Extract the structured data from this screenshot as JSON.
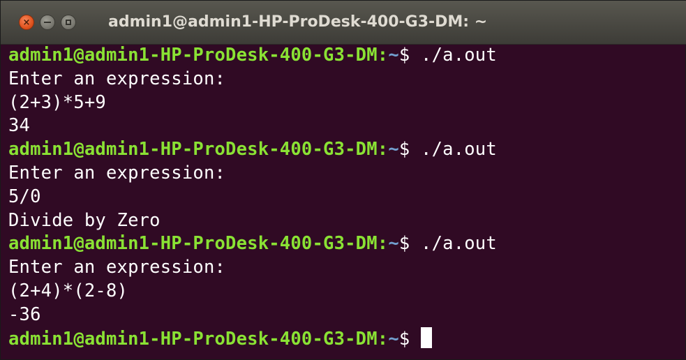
{
  "window": {
    "title": "admin1@admin1-HP-ProDesk-400-G3-DM: ~",
    "close_glyph": "×"
  },
  "terminal": {
    "prompt_user": "admin1@admin1-HP-ProDesk-400-G3-DM",
    "prompt_sep": ":",
    "prompt_path": "~",
    "prompt_symbol": "$",
    "lines": [
      {
        "type": "prompt",
        "command": "./a.out"
      },
      {
        "type": "output",
        "text": "Enter an expression:"
      },
      {
        "type": "output",
        "text": "(2+3)*5+9"
      },
      {
        "type": "output",
        "text": "34"
      },
      {
        "type": "prompt",
        "command": "./a.out"
      },
      {
        "type": "output",
        "text": "Enter an expression:"
      },
      {
        "type": "output",
        "text": "5/0"
      },
      {
        "type": "output",
        "text": "Divide by Zero"
      },
      {
        "type": "prompt",
        "command": "./a.out"
      },
      {
        "type": "output",
        "text": "Enter an expression:"
      },
      {
        "type": "output",
        "text": "(2+4)*(2-8)"
      },
      {
        "type": "output",
        "text": "-36"
      },
      {
        "type": "prompt",
        "command": "",
        "cursor": true
      }
    ]
  },
  "colors": {
    "background": "#300a24",
    "prompt_user": "#8ae234",
    "prompt_path": "#729fcf",
    "text": "#ffffff",
    "close_button": "#e0531e"
  }
}
